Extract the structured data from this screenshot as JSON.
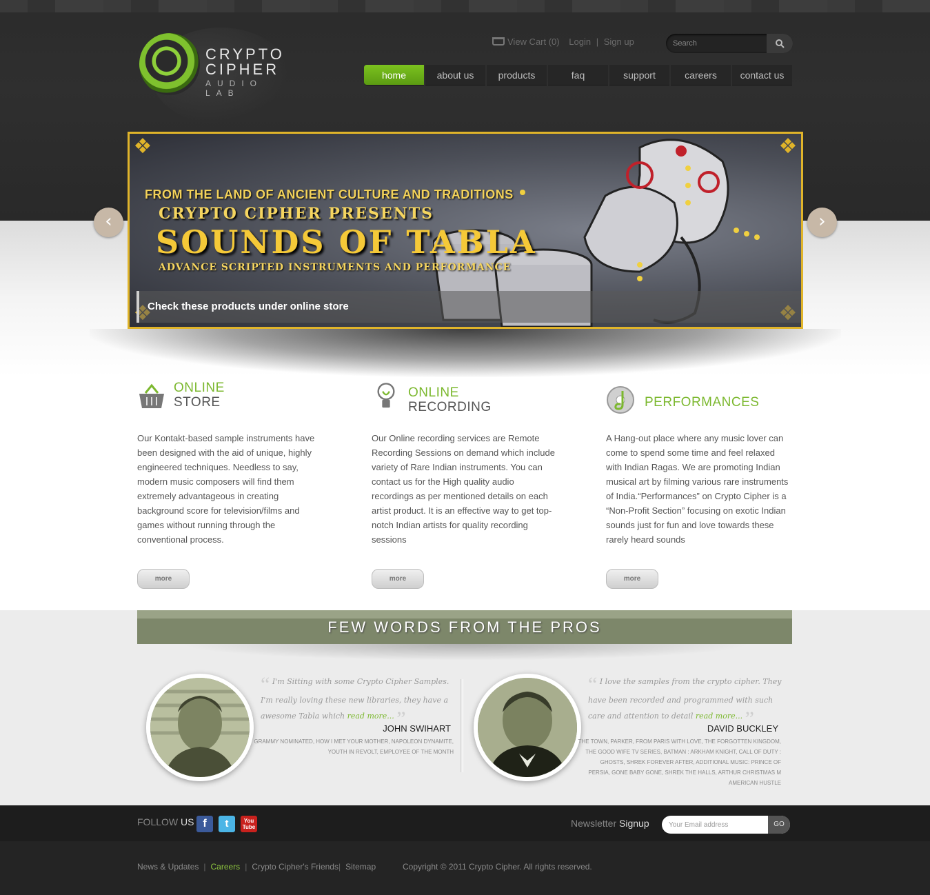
{
  "header": {
    "logo": {
      "line1": "CRYPTO",
      "line2": "CIPHER",
      "line3": "AUDIO LAB"
    },
    "links": {
      "cart": "View Cart (0)",
      "login": "Login",
      "separator": "|",
      "signup": "Sign up"
    },
    "search": {
      "placeholder": "Search",
      "icon": "search-icon"
    },
    "nav": [
      {
        "label": "home",
        "active": true
      },
      {
        "label": "about us"
      },
      {
        "label": "products"
      },
      {
        "label": "faq"
      },
      {
        "label": "support"
      },
      {
        "label": "careers"
      },
      {
        "label": "contact us"
      }
    ]
  },
  "slider": {
    "line1": "FROM THE LAND OF ANCIENT CULTURE AND TRADITIONS",
    "line2": "CRYPTO CIPHER PRESENTS",
    "line3": "SOUNDS OF TABLA",
    "line4": "ADVANCE SCRIPTED INSTRUMENTS AND PERFORMANCE",
    "caption": "Check these products under online store",
    "prev_icon": "chevron-left-icon",
    "next_icon": "chevron-right-icon"
  },
  "features": [
    {
      "title1": "ONLINE",
      "title2": "STORE",
      "icon": "basket-icon",
      "text": "Our Kontakt-based sample instruments have been designed with the aid of unique, highly engineered techniques. Needless to say, modern music composers will find them extremely advantageous in creating background score for television/films and games without running through the conventional process.",
      "more": "more"
    },
    {
      "title1": "ONLINE",
      "title2": "RECORDING",
      "icon": "lightbulb-icon",
      "text": "Our Online recording services are Remote Recording Sessions on demand which include variety of Rare Indian instruments. You can contact us for the High quality audio recordings as per mentioned details on each artist product. It is an effective way to get top-notch Indian artists for quality recording sessions",
      "more": "more"
    },
    {
      "title1": "PERFORMANCES",
      "title2": "",
      "icon": "disc-music-icon",
      "text": "A Hang-out place where any music lover can come to spend some time and feel relaxed with Indian Ragas. We are promoting Indian musical art by filming various rare instruments of India.“Performances” on Crypto Cipher is a “Non-Profit Section” focusing on exotic Indian sounds just for fun and love towards these rarely heard sounds",
      "more": "more"
    }
  ],
  "pros": {
    "heading": "FEW WORDS FROM THE PROS",
    "items": [
      {
        "quote": "I'm Sitting with some Crypto Cipher Samples. I'm really loving these new libraries, they have a awesome Tabla which",
        "read_more": "read more...",
        "name": "JOHN SWIHART",
        "credits": "GRAMMY NOMINATED, HOW I MET YOUR MOTHER, NAPOLEON DYNAMITE, YOUTH IN REVOLT, EMPLOYEE OF THE MONTH"
      },
      {
        "quote": "I love the samples from the crypto cipher. They have been recorded and programmed with such care and attention to detail",
        "read_more": "read more...",
        "name": "DAVID BUCKLEY",
        "credits": "THE TOWN, PARKER, FROM PARIS WITH LOVE, THE FORGOTTEN KINGDOM, THE GOOD WIFE TV SERIES, BATMAN : ARKHAM KNIGHT, CALL OF DUTY : GHOSTS, SHREK FOREVER AFTER, Additional Music: PRINCE OF PERSIA, GONE BABY GONE, SHREK THE HALLS, ARTHUR CHRISTMAS M AMERICAN HUSTLE"
      }
    ]
  },
  "social": {
    "follow": "FOLLOW",
    "us": "US",
    "facebook": "f",
    "twitter": "t",
    "youtube_top": "You",
    "youtube_bottom": "Tube",
    "newsletter": "Newsletter",
    "signup": "Signup",
    "email_placeholder": "Your Email address",
    "go": "GO"
  },
  "footer": {
    "links": [
      "News & Updates",
      "Careers",
      "Crypto Cipher's Friends",
      "Sitemap"
    ],
    "seps": [
      "|",
      "|",
      "|"
    ],
    "copyright": "Copyright © 2011 Crypto Cipher. All rights reserved."
  },
  "colors": {
    "accent_green": "#7cb82f",
    "nav_active": "#6aaf18",
    "slider_border": "#e0b42a",
    "pros_bar": "#7d876a"
  }
}
